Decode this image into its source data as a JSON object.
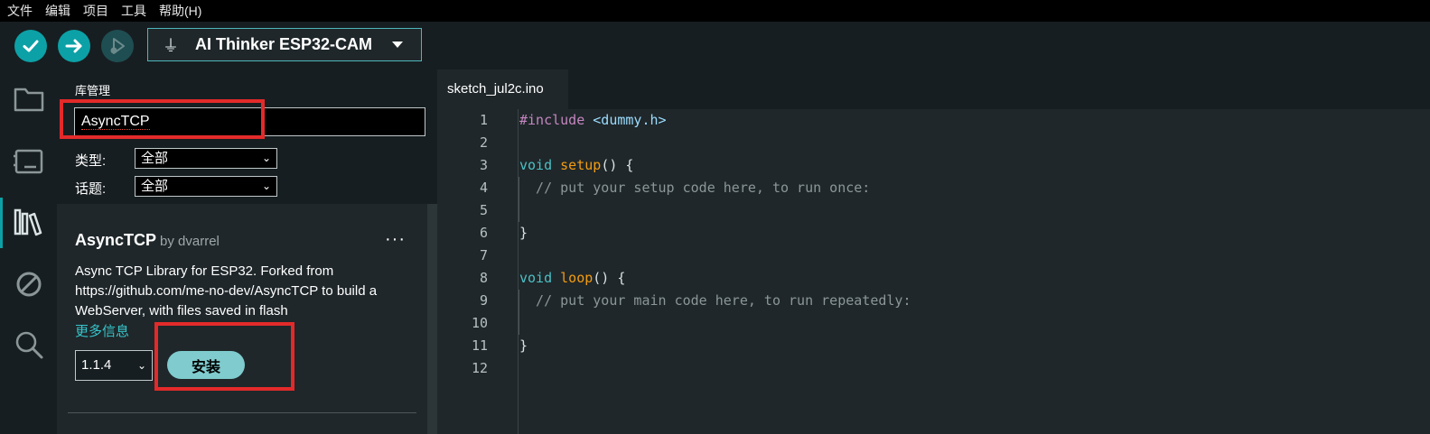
{
  "menubar": {
    "items": [
      "文件",
      "编辑",
      "项目",
      "工具",
      "帮助(H)"
    ]
  },
  "toolbar": {
    "buttons": [
      {
        "name": "verify",
        "icon": "check-icon"
      },
      {
        "name": "upload",
        "icon": "arrow-right-icon"
      },
      {
        "name": "debug",
        "icon": "debug-icon"
      }
    ],
    "board": "AI Thinker ESP32-CAM"
  },
  "sidebar": {
    "icons": [
      "folder-icon",
      "board-icon",
      "library-icon",
      "blocked-icon",
      "search-icon"
    ],
    "active": "library-icon"
  },
  "library": {
    "title": "库管理",
    "search_value": "AsyncTCP",
    "filters": [
      {
        "label": "类型:",
        "value": "全部"
      },
      {
        "label": "话题:",
        "value": "全部"
      }
    ],
    "card": {
      "name": "AsyncTCP",
      "by": "by dvarrel",
      "menu": "···",
      "description": "Async TCP Library for ESP32. Forked from https://github.com/me-no-dev/AsyncTCP to build a WebServer, with files saved in flash",
      "more_info": "更多信息",
      "version": "1.1.4",
      "install_label": "安装"
    }
  },
  "editor": {
    "tab": "sketch_jul2c.ino",
    "lines": [
      {
        "n": "1"
      },
      {
        "n": "2"
      },
      {
        "n": "3"
      },
      {
        "n": "4"
      },
      {
        "n": "5"
      },
      {
        "n": "6"
      },
      {
        "n": "7"
      },
      {
        "n": "8"
      },
      {
        "n": "9"
      },
      {
        "n": "10"
      },
      {
        "n": "11"
      },
      {
        "n": "12"
      }
    ],
    "code": {
      "l1_pre": "#include",
      "l1_inc": " <dummy.h>",
      "l3_kw": "void",
      "l3_fn": " setup",
      "l3_rest": "() {",
      "l4_cm": "  // put your setup code here, to run once:",
      "l6": "}",
      "l8_kw": "void",
      "l8_fn": " loop",
      "l8_rest": "() {",
      "l9_cm": "  // put your main code here, to run repeatedly:",
      "l11": "}"
    }
  },
  "colors": {
    "accent": "#0ca1a6",
    "highlight_box": "#e32a2a",
    "install_bg": "#7fcbcd"
  }
}
